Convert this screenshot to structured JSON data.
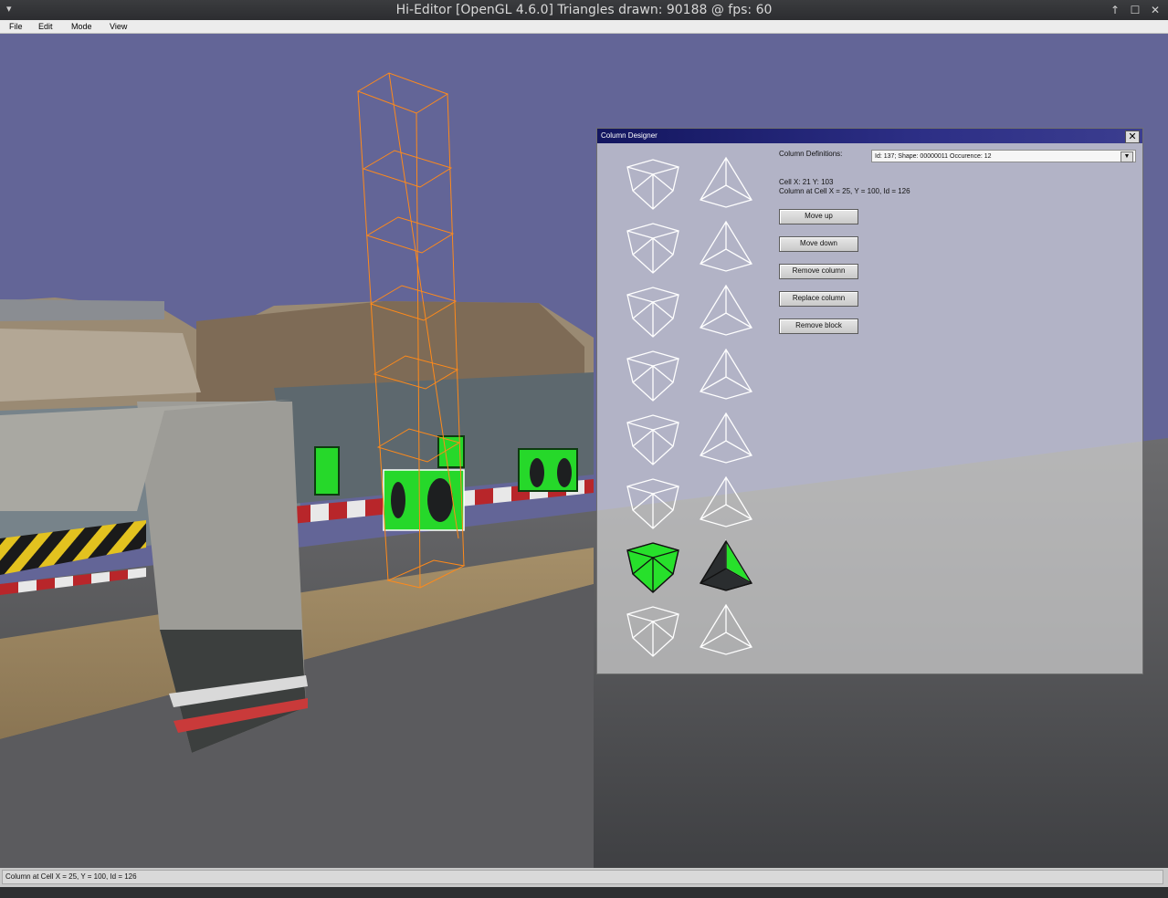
{
  "window": {
    "title": "Hi-Editor [OpenGL 4.6.0] Triangles drawn: 90188 @ fps: 60",
    "menu_glyph": "▾",
    "up_glyph": "↑",
    "maximize_glyph": "☐",
    "close_glyph": "✕"
  },
  "menu": [
    "File",
    "Edit",
    "Mode",
    "View"
  ],
  "designer": {
    "title": "Column Designer",
    "close_glyph": "✕",
    "column_definitions_label": "Column Definitions:",
    "selected_definition": "Id: 137; Shape: 00000011 Occurence: 12",
    "dropdown_glyph": "▼",
    "cell_info": "Cell X: 21 Y: 103",
    "column_info": "Column at Cell X = 25, Y = 100, Id = 126",
    "buttons": {
      "move_up": "Move up",
      "move_down": "Move down",
      "remove_column": "Remove column",
      "replace_column": "Replace column",
      "remove_block": "Remove block"
    }
  },
  "status": {
    "text": "Column at Cell X = 25, Y = 100, Id = 126"
  },
  "colors": {
    "sky": "#636597",
    "wireframe": "#ff8a1a",
    "block_green": "#27e02b",
    "title_blue": "#13165f"
  }
}
